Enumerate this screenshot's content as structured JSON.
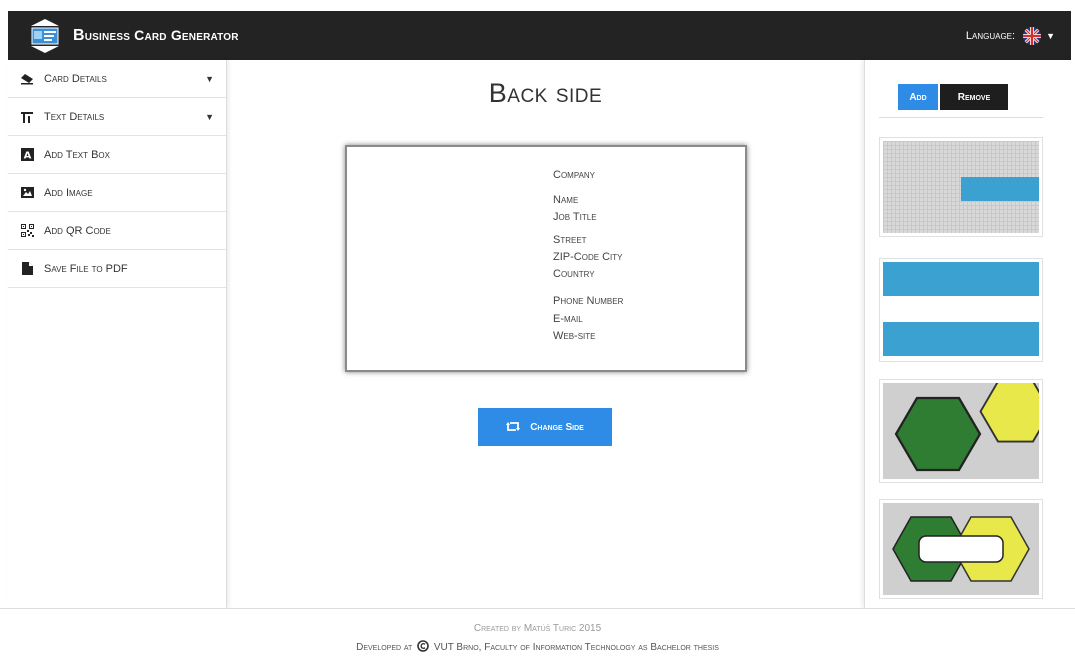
{
  "header": {
    "title": "Business Card Generator",
    "language_label": "Language:",
    "language_flag": "uk-flag"
  },
  "sidebar": {
    "items": [
      {
        "label": "Card Details",
        "icon": "eraser-icon",
        "has_dropdown": true
      },
      {
        "label": "Text Details",
        "icon": "text-height-icon",
        "has_dropdown": true
      },
      {
        "label": "Add Text Box",
        "icon": "text-box-icon",
        "has_dropdown": false
      },
      {
        "label": "Add Image",
        "icon": "image-icon",
        "has_dropdown": false
      },
      {
        "label": "Add QR Code",
        "icon": "qr-code-icon",
        "has_dropdown": false
      },
      {
        "label": "Save File to PDF",
        "icon": "file-icon",
        "has_dropdown": false
      }
    ]
  },
  "main": {
    "side_title": "Back side",
    "card": {
      "company": "Company",
      "name": "Name",
      "job_title": "Job Title",
      "street": "Street",
      "zip_city": "ZIP-Code City",
      "country": "Country",
      "phone": "Phone Number",
      "email": "E-mail",
      "website": "Web-site"
    },
    "change_side_label": "Change Side"
  },
  "right_panel": {
    "add_label": "Add",
    "remove_label": "Remove"
  },
  "footer": {
    "line1": "Created by Matúš Turic 2015",
    "line2_prefix": "Developed at",
    "line2_rest": "VUT Brno, Faculty of Information Technology as Bachelor thesis"
  },
  "colors": {
    "accent": "#2e8be6",
    "topbar": "#232323",
    "thumb_blue": "#3aa1d0",
    "hex_green": "#2e7d32",
    "hex_yellow": "#e8e84a"
  }
}
